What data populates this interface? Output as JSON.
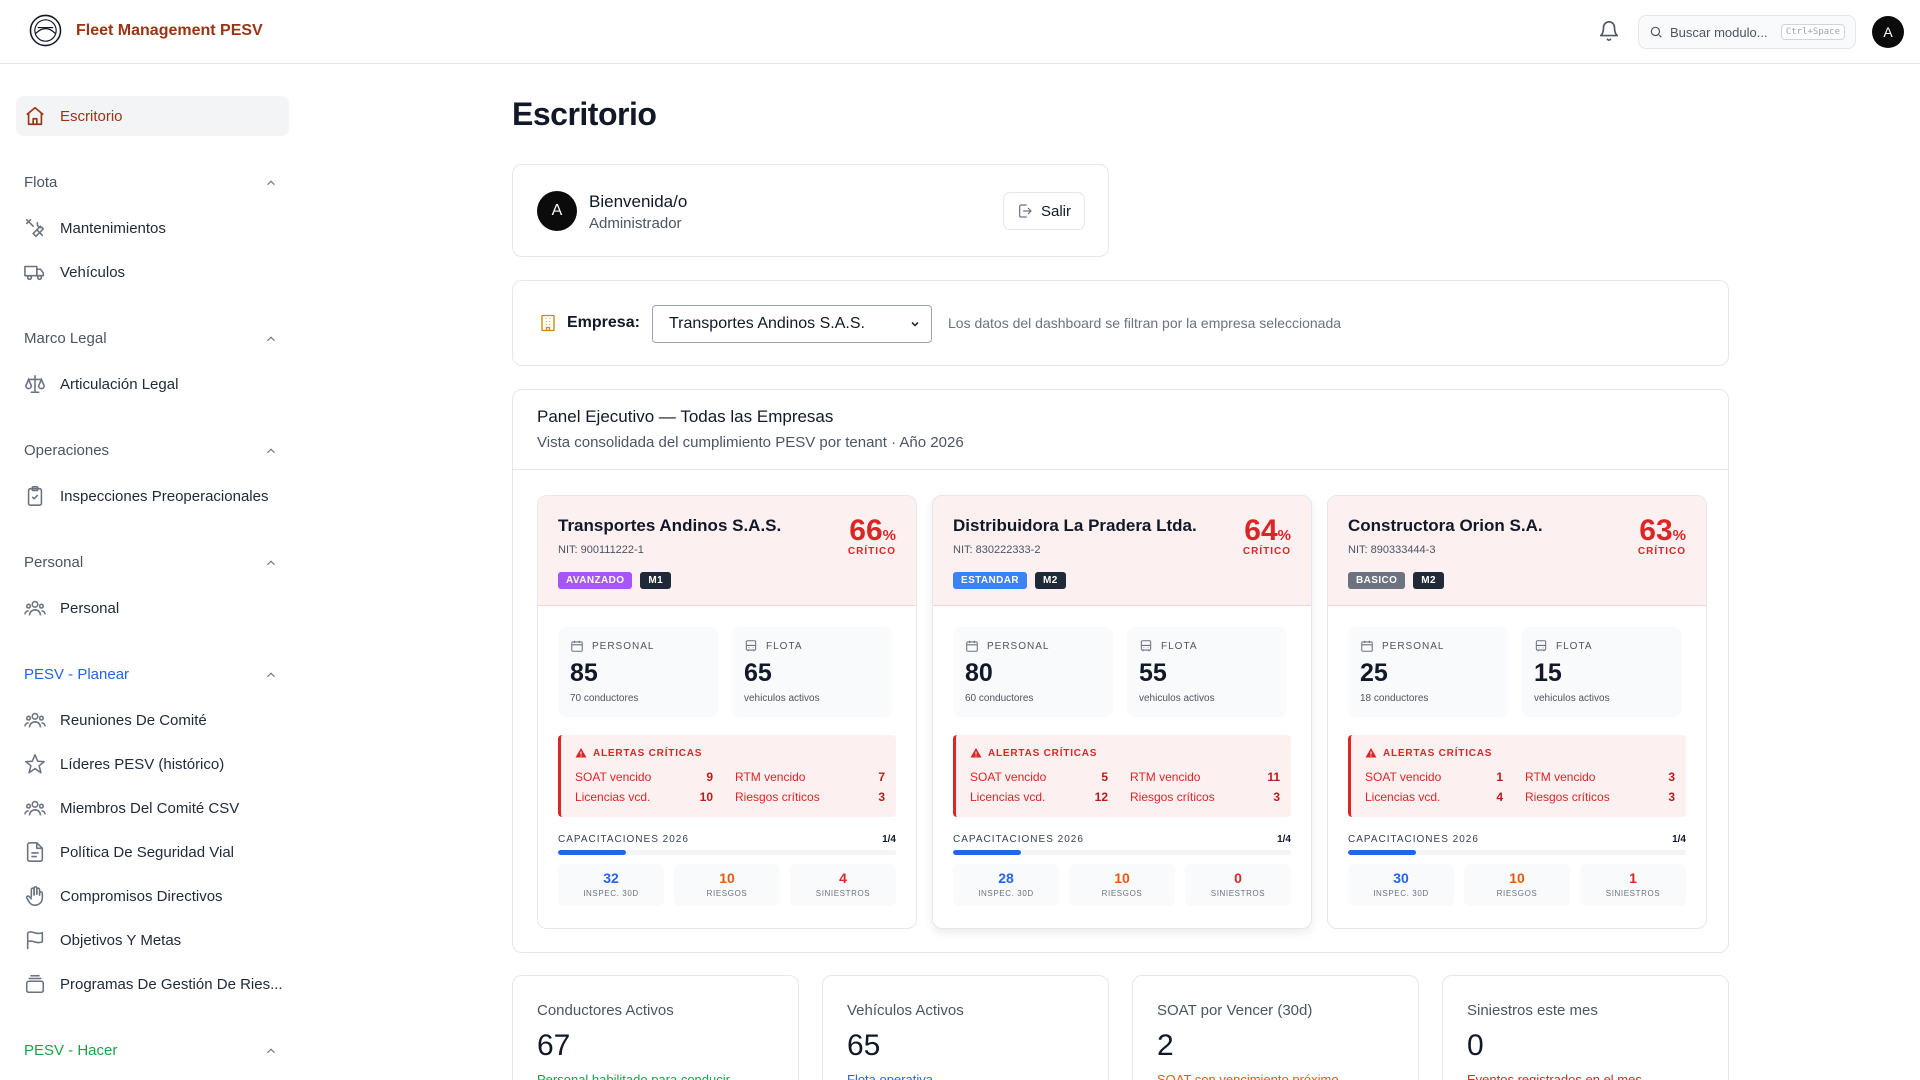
{
  "header": {
    "brand": "Fleet Management PESV",
    "search_placeholder": "Buscar modulo...",
    "search_shortcut": "Ctrl+Space",
    "avatar_initial": "A"
  },
  "sidebar": {
    "items": [
      {
        "label": "Escritorio",
        "icon": "home-icon",
        "active": true
      },
      {
        "group": "Flota"
      },
      {
        "label": "Mantenimientos",
        "icon": "tools-icon"
      },
      {
        "label": "Vehículos",
        "icon": "truck-icon"
      },
      {
        "group": "Marco Legal"
      },
      {
        "label": "Articulación Legal",
        "icon": "scale-icon"
      },
      {
        "group": "Operaciones"
      },
      {
        "label": "Inspecciones Preoperacionales",
        "icon": "clipboard-icon"
      },
      {
        "group": "Personal"
      },
      {
        "label": "Personal",
        "icon": "users-icon"
      },
      {
        "group": "PESV - Planear",
        "color": "#2563eb"
      },
      {
        "label": "Reuniones De Comité",
        "icon": "users-icon"
      },
      {
        "label": "Líderes PESV (histórico)",
        "icon": "star-icon"
      },
      {
        "label": "Miembros Del Comité CSV",
        "icon": "users-icon"
      },
      {
        "label": "Política De Seguridad Vial",
        "icon": "document-icon"
      },
      {
        "label": "Compromisos Directivos",
        "icon": "hand-icon"
      },
      {
        "label": "Objetivos Y Metas",
        "icon": "flag-icon"
      },
      {
        "label": "Programas De Gestión De Ries...",
        "icon": "layers-icon"
      },
      {
        "group": "PESV - Hacer",
        "color": "#16a34a"
      }
    ]
  },
  "page": {
    "title": "Escritorio"
  },
  "welcome": {
    "avatar_initial": "A",
    "title": "Bienvenida/o",
    "role": "Administrador",
    "logout_label": "Salir"
  },
  "company": {
    "label": "Empresa:",
    "selected": "Transportes Andinos S.A.S.",
    "hint": "Los datos del dashboard se filtran por la empresa seleccionada"
  },
  "panel": {
    "title": "Panel Ejecutivo — Todas las Empresas",
    "subtitle": "Vista consolidada del cumplimiento PESV por tenant · Año 2026",
    "labels": {
      "personal": "PERSONAL",
      "flota": "FLOTA",
      "vehicles_sub": "vehiculos activos",
      "alerts": "ALERTAS CRÍTICAS",
      "soat": "SOAT vencido",
      "rtm": "RTM vencido",
      "licencias": "Licencias vcd.",
      "riesgos": "Riesgos críticos",
      "capacitaciones": "CAPACITACIONES 2026",
      "inspec": "INSPEC. 30D",
      "riesgos_mini": "RIESGOS",
      "siniestros": "SINIESTROS"
    },
    "tenants": [
      {
        "name": "Transportes Andinos S.A.S.",
        "nit": "NIT: 900111222-1",
        "pct": "66",
        "pct_sym": "%",
        "level": "CRÍTICO",
        "badge1": "AVANZADO",
        "badge1_color": "#a855f7",
        "badge2": "M1",
        "personal": "85",
        "personal_sub": "70 conductores",
        "flota": "65",
        "soat": "9",
        "rtm": "7",
        "licencias": "10",
        "riesgos": "3",
        "cap": "1/4",
        "cap_fraction": 0.2,
        "inspec": "32",
        "riesgos_mini": "10",
        "siniestros": "4"
      },
      {
        "name": "Distribuidora La Pradera Ltda.",
        "nit": "NIT: 830222333-2",
        "pct": "64",
        "pct_sym": "%",
        "level": "CRÍTICO",
        "badge1": "ESTANDAR",
        "badge1_color": "#3b82f6",
        "badge2": "M2",
        "personal": "80",
        "personal_sub": "60 conductores",
        "flota": "55",
        "soat": "5",
        "rtm": "11",
        "licencias": "12",
        "riesgos": "3",
        "cap": "1/4",
        "cap_fraction": 0.2,
        "inspec": "28",
        "riesgos_mini": "10",
        "siniestros": "0"
      },
      {
        "name": "Constructora Orion S.A.",
        "nit": "NIT: 890333444-3",
        "pct": "63",
        "pct_sym": "%",
        "level": "CRÍTICO",
        "badge1": "BASICO",
        "badge1_color": "#6b7280",
        "badge2": "M2",
        "personal": "25",
        "personal_sub": "18 conductores",
        "flota": "15",
        "soat": "1",
        "rtm": "3",
        "licencias": "4",
        "riesgos": "3",
        "cap": "1/4",
        "cap_fraction": 0.2,
        "inspec": "30",
        "riesgos_mini": "10",
        "siniestros": "1"
      }
    ]
  },
  "kpis": [
    {
      "label": "Conductores Activos",
      "value": "67",
      "sub": "Personal habilitado para conducir",
      "sub_color": "#16a34a"
    },
    {
      "label": "Vehículos Activos",
      "value": "65",
      "sub": "Flota operativa",
      "sub_color": "#2563eb"
    },
    {
      "label": "SOAT por Vencer (30d)",
      "value": "2",
      "sub": "SOAT con vencimiento próximo",
      "sub_color": "#ea580c"
    },
    {
      "label": "Siniestros este mes",
      "value": "0",
      "sub": "Eventos registrados en el mes",
      "sub_color": "#dc2626"
    }
  ],
  "colors": {
    "brand": "#9a3412",
    "critical": "#dc2626",
    "blue": "#2563eb",
    "orange": "#ea580c"
  }
}
